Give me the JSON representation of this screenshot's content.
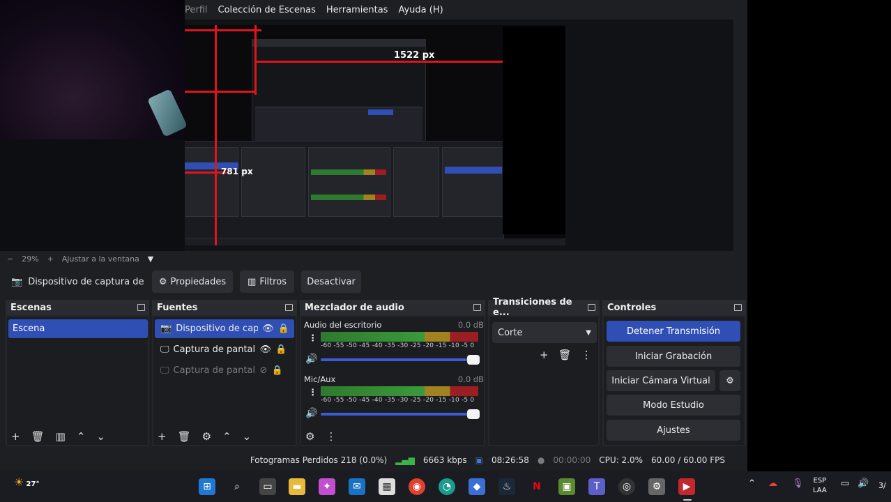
{
  "menu": {
    "profile": "Perfil",
    "scene_collection": "Colección de Escenas",
    "tools": "Herramientas",
    "help": "Ayuda (H)"
  },
  "preview": {
    "measure_top": "1522 px",
    "measure_left": "781 px"
  },
  "zoom": {
    "minus": "−",
    "level": "29%",
    "plus": "+",
    "fit": "Ajustar a la ventana"
  },
  "source_toolbar": {
    "source_name": "Dispositivo de captura de v",
    "properties": "Propiedades",
    "filters": "Filtros",
    "deactivate": "Desactivar"
  },
  "scenes": {
    "title": "Escenas",
    "items": [
      "Escena"
    ]
  },
  "sources": {
    "title": "Fuentes",
    "items": [
      {
        "label": "Dispositivo de captu",
        "selected": true,
        "visible": true
      },
      {
        "label": "Captura de pantalla",
        "selected": false,
        "visible": true
      },
      {
        "label": "Captura de pantalla",
        "selected": false,
        "visible": false
      }
    ]
  },
  "mixer": {
    "title": "Mezclador de audio",
    "channels": [
      {
        "name": "Audio del escritorio",
        "db": "0.0 dB"
      },
      {
        "name": "Mic/Aux",
        "db": "0.0 dB"
      }
    ],
    "ticks": "-60 -55 -50 -45 -40 -35 -30 -25 -20 -15 -10 -5 0"
  },
  "transitions": {
    "title": "Transiciones de e...",
    "selected": "Corte"
  },
  "controls": {
    "title": "Controles",
    "stop_stream": "Detener Transmisión",
    "start_recording": "Iniciar Grabación",
    "start_virtual_cam": "Iniciar Cámara Virtual",
    "studio_mode": "Modo Estudio",
    "settings": "Ajustes"
  },
  "status": {
    "dropped_frames": "Fotogramas Perdidos 218 (0.0%)",
    "bitrate": "6663 kbps",
    "stream_time": "08:26:58",
    "rec_time": "00:00:00",
    "cpu": "CPU: 2.0%",
    "fps": "60.00 / 60.00 FPS"
  },
  "taskbar": {
    "temperature": "27°",
    "lang_top": "ESP",
    "lang_bottom": "LAA",
    "clock_partial": "3/"
  },
  "colors": {
    "accent": "#2f4fb5",
    "measure_line": "#e0141c",
    "window_bg": "#1e1f23"
  }
}
